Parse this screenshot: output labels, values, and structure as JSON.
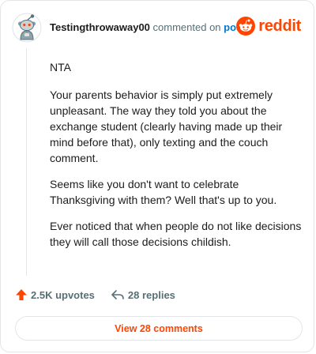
{
  "header": {
    "username": "Testingthrowaway00",
    "action": "commented on",
    "target": "post",
    "brand": "reddit"
  },
  "comment": {
    "paragraphs": [
      "NTA",
      "Your parents behavior is simply put extremely unpleasant. The way they told you about the exchange student (clearly having made up their mind before that), only texting and the couch comment.",
      "Seems like you don't want to celebrate Thanksgiving with them? Well that's up to you.",
      "Ever noticed that when people do not like decisions they will call those decisions childish."
    ]
  },
  "stats": {
    "upvotes": "2.5K upvotes",
    "replies": "28 replies"
  },
  "footer": {
    "view_comments": "View 28 comments"
  },
  "colors": {
    "brand": "#ff4500",
    "link": "#0079d3",
    "muted": "#576f76"
  },
  "icons": {
    "avatar": "snoo-avatar-icon",
    "brand": "reddit-logo-icon",
    "upvote": "upvote-arrow-icon",
    "reply": "reply-arrow-icon"
  }
}
